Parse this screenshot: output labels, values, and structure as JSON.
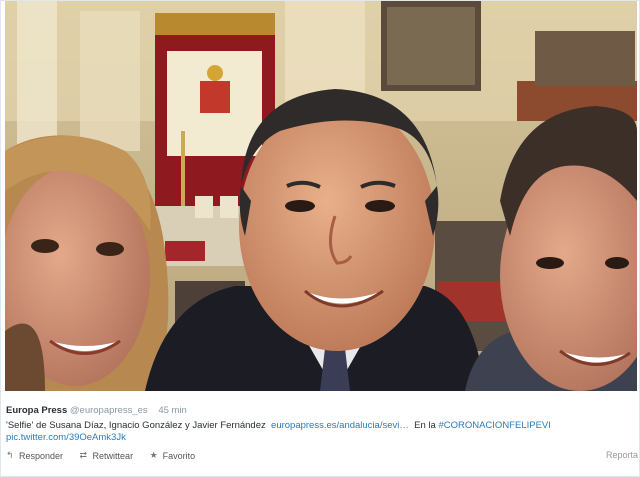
{
  "tweet": {
    "author": "Europa Press",
    "handle": "@europapress_es",
    "time": "45 min",
    "text": "'Selfie' de Susana Díaz, Ignacio González y Javier Fernández",
    "link": "europapress.es/andalucia/sevi…",
    "text2": "En la",
    "hashtag": "#CORONACIONFELIPEVI",
    "pic_link": "pic.twitter.com/39OeAmk3Jk"
  },
  "actions": {
    "reply": "Responder",
    "retweet": "Retwittear",
    "favorite": "Favorito",
    "report": "Reporta"
  },
  "icons": {
    "reply": "reply-arrow-icon",
    "retweet": "retweet-icon",
    "favorite": "star-icon"
  },
  "colors": {
    "link": "#2b7bb9",
    "muted": "#8899a6"
  }
}
